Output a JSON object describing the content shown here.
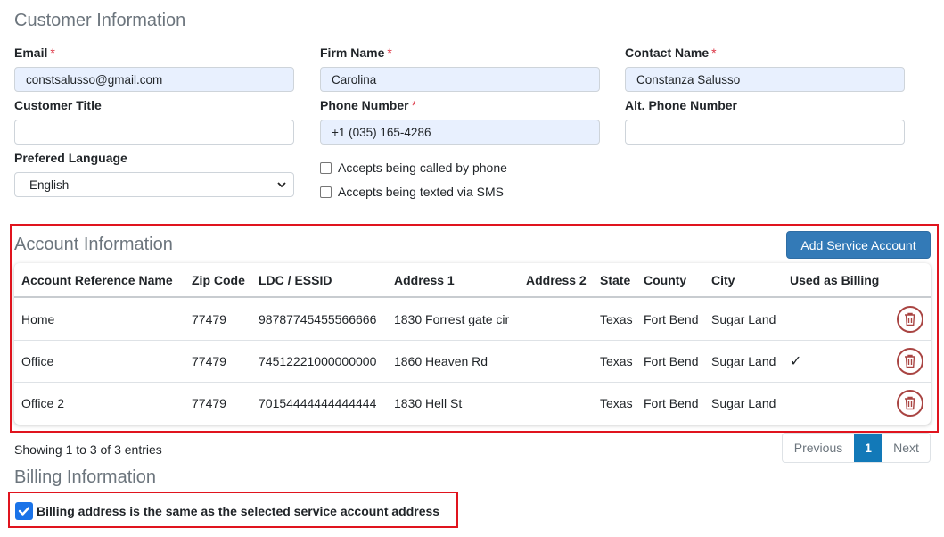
{
  "customer": {
    "title": "Customer Information",
    "email_label": "Email",
    "email_value": "constsalusso@gmail.com",
    "firm_label": "Firm Name",
    "firm_value": "Carolina",
    "contact_label": "Contact Name",
    "contact_value": "Constanza Salusso",
    "cust_title_label": "Customer Title",
    "cust_title_value": "",
    "phone_label": "Phone Number",
    "phone_value": "+1 (035) 165-4286",
    "alt_phone_label": "Alt. Phone Number",
    "alt_phone_value": "",
    "lang_label": "Prefered Language",
    "lang_value": "English",
    "called_label": "Accepts being called by phone",
    "texted_label": "Accepts being texted via SMS",
    "required_mark": "*"
  },
  "account": {
    "title": "Account Information",
    "add_button": "Add Service Account",
    "headers": [
      "Account Reference Name",
      "Zip Code",
      "LDC / ESSID",
      "Address 1",
      "Address 2",
      "State",
      "County",
      "City",
      "Used as Billing"
    ],
    "rows": [
      {
        "name": "Home",
        "zip": "77479",
        "ldc": "98787745455566666",
        "addr1": "1830 Forrest gate cir",
        "addr2": "",
        "state": "Texas",
        "county": "Fort Bend",
        "city": "Sugar Land",
        "billing": ""
      },
      {
        "name": "Office",
        "zip": "77479",
        "ldc": "74512221000000000",
        "addr1": "1860 Heaven Rd",
        "addr2": "",
        "state": "Texas",
        "county": "Fort Bend",
        "city": "Sugar Land",
        "billing": "✓"
      },
      {
        "name": "Office 2",
        "zip": "77479",
        "ldc": "70154444444444444",
        "addr1": "1830 Hell St",
        "addr2": "",
        "state": "Texas",
        "county": "Fort Bend",
        "city": "Sugar Land",
        "billing": ""
      }
    ],
    "showing": "Showing 1 to 3 of 3 entries",
    "pager": {
      "prev": "Previous",
      "page": "1",
      "next": "Next"
    }
  },
  "billing": {
    "title": "Billing Information",
    "same_label": "Billing address is the same as the selected service account address"
  },
  "colors": {
    "accent": "#337ab7",
    "highlight": "#e0141e",
    "delete": "#a94442"
  }
}
